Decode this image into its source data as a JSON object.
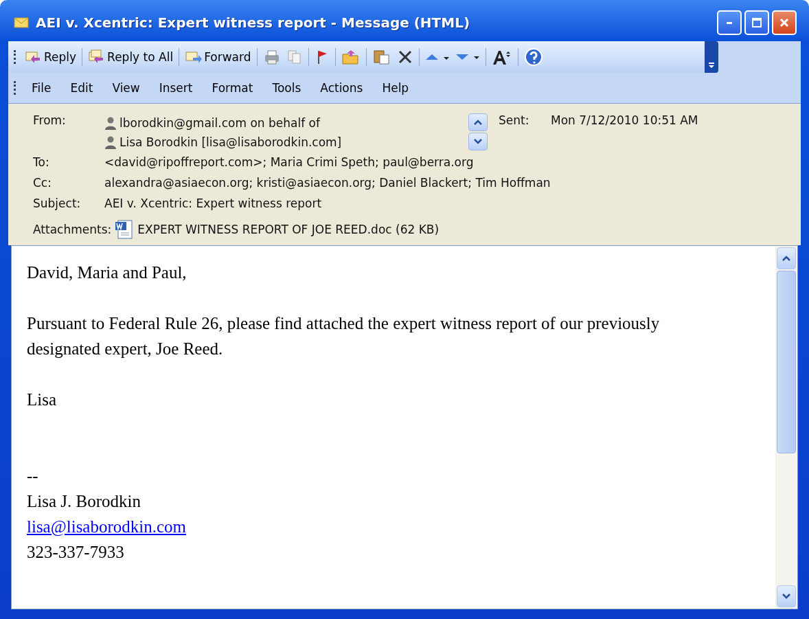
{
  "window": {
    "title": "AEI v. Xcentric: Expert witness report - Message (HTML)"
  },
  "toolbar": [
    {
      "kind": "reply",
      "label": "Reply"
    },
    {
      "kind": "reply-all",
      "label": "Reply to All"
    },
    {
      "kind": "forward",
      "label": "Forward"
    },
    {
      "kind": "print"
    },
    {
      "kind": "copy"
    },
    {
      "kind": "flag"
    },
    {
      "kind": "move"
    },
    {
      "kind": "paste"
    },
    {
      "kind": "delete"
    },
    {
      "kind": "up"
    },
    {
      "kind": "down"
    },
    {
      "kind": "font"
    },
    {
      "kind": "help"
    }
  ],
  "menu": [
    {
      "label": "File"
    },
    {
      "label": "Edit"
    },
    {
      "label": "View"
    },
    {
      "label": "Insert"
    },
    {
      "label": "Format"
    },
    {
      "label": "Tools"
    },
    {
      "label": "Actions"
    },
    {
      "label": "Help"
    }
  ],
  "header": {
    "from_label": "From:",
    "from": [
      "lborodkin@gmail.com on behalf of",
      "Lisa Borodkin [lisa@lisaborodkin.com]"
    ],
    "sent_label": "Sent:",
    "sent": "Mon 7/12/2010 10:51 AM",
    "to_label": "To:",
    "to": "<david@ripoffreport.com>; Maria Crimi Speth; paul@berra.org",
    "cc_label": "Cc:",
    "cc": "alexandra@asiaecon.org; kristi@asiaecon.org; Daniel Blackert; Tim Hoffman",
    "subject_label": "Subject:",
    "subject": "AEI v. Xcentric: Expert witness report",
    "attachments_label": "Attachments:",
    "attachment": "EXPERT WITNESS REPORT OF JOE REED.doc (62 KB)"
  },
  "body": [
    {
      "kind": "text",
      "text": "David, Maria and Paul,"
    },
    {
      "kind": "gap"
    },
    {
      "kind": "text",
      "text": "Pursuant to Federal Rule 26, please find attached the expert witness report of our previously designated expert, Joe Reed."
    },
    {
      "kind": "gap"
    },
    {
      "kind": "text",
      "text": "Lisa"
    },
    {
      "kind": "gap"
    },
    {
      "kind": "gap"
    },
    {
      "kind": "text",
      "text": "--"
    },
    {
      "kind": "text",
      "text": "Lisa J. Borodkin"
    },
    {
      "kind": "link",
      "text": "lisa@lisaborodkin.com"
    },
    {
      "kind": "text",
      "text": "323-337-7933"
    }
  ]
}
